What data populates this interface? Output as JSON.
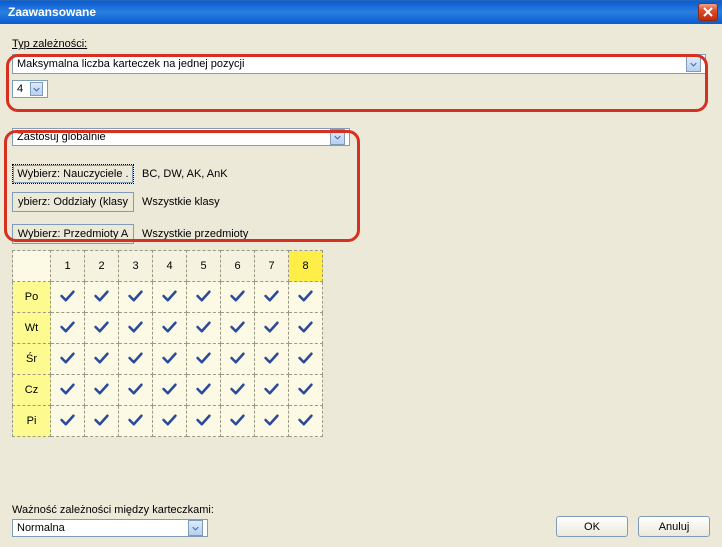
{
  "window": {
    "title": "Zaawansowane"
  },
  "labels": {
    "dependency_type": "Typ zależności:",
    "importance": "Ważność zależności między karteczkami:"
  },
  "selects": {
    "dependency_type_value": "Maksymalna liczba karteczek na jednej pozycji",
    "number_value": "4",
    "apply_scope_value": "Zastosuj globalnie",
    "importance_value": "Normalna"
  },
  "pickers": {
    "teachers_btn": "Wybierz: Nauczyciele .",
    "teachers_value": "BC, DW, AK, AnK",
    "classes_btn": "ybierz: Oddziały (klasy",
    "classes_value": "Wszystkie klasy",
    "subjects_btn": "Wybierz: Przedmioty A",
    "subjects_value": "Wszystkie przedmioty"
  },
  "grid": {
    "columns": [
      "1",
      "2",
      "3",
      "4",
      "5",
      "6",
      "7",
      "8"
    ],
    "rows": [
      "Po",
      "Wt",
      "Śr",
      "Cz",
      "Pi"
    ]
  },
  "buttons": {
    "ok": "OK",
    "cancel": "Anuluj"
  }
}
